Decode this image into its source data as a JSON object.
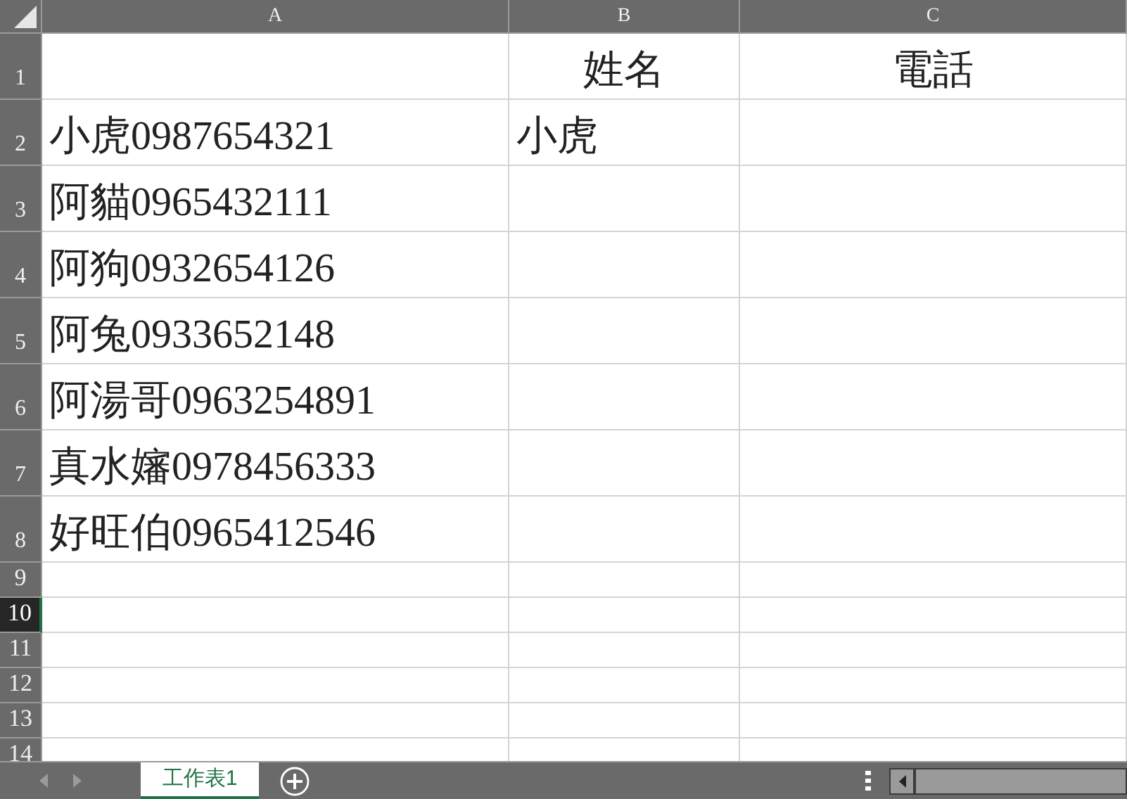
{
  "columns": [
    {
      "label": "A",
      "selected": false
    },
    {
      "label": "B",
      "selected": false
    },
    {
      "label": "C",
      "selected": false
    }
  ],
  "rows": [
    {
      "number": "1",
      "selected": false,
      "column_b": "姓名",
      "column_c": "電話"
    },
    {
      "number": "2",
      "selected": false,
      "column_a": "小虎0987654321",
      "column_b": "小虎"
    },
    {
      "number": "3",
      "selected": false,
      "column_a": "阿貓0965432111"
    },
    {
      "number": "4",
      "selected": false,
      "column_a": "阿狗0932654126"
    },
    {
      "number": "5",
      "selected": false,
      "column_a": "阿兔0933652148"
    },
    {
      "number": "6",
      "selected": false,
      "column_a": "阿湯哥0963254891"
    },
    {
      "number": "7",
      "selected": false,
      "column_a": "真水嬸0978456333"
    },
    {
      "number": "8",
      "selected": false,
      "column_a": "好旺伯0965412546"
    },
    {
      "number": "9",
      "selected": false
    },
    {
      "number": "10",
      "selected": true
    },
    {
      "number": "11",
      "selected": false
    },
    {
      "number": "12",
      "selected": false
    },
    {
      "number": "13",
      "selected": false
    },
    {
      "number": "14",
      "selected": false
    }
  ],
  "sheet_tabs": [
    {
      "label": "工作表1",
      "selected": true
    }
  ]
}
